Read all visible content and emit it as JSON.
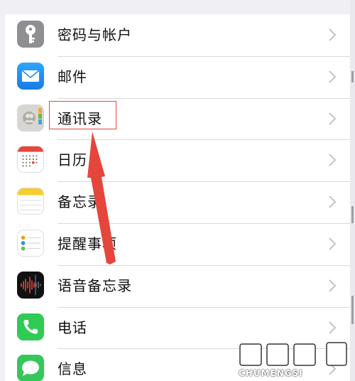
{
  "settings_list": {
    "items": [
      {
        "label": "密码与帐户",
        "icon": "key-icon"
      },
      {
        "label": "邮件",
        "icon": "mail-icon"
      },
      {
        "label": "通讯录",
        "icon": "contacts-icon"
      },
      {
        "label": "日历",
        "icon": "calendar-icon"
      },
      {
        "label": "备忘录",
        "icon": "notes-icon"
      },
      {
        "label": "提醒事项",
        "icon": "reminders-icon"
      },
      {
        "label": "语音备忘录",
        "icon": "voice-memos-icon"
      },
      {
        "label": "电话",
        "icon": "phone-icon"
      },
      {
        "label": "信息",
        "icon": "messages-icon"
      }
    ]
  },
  "annotation": {
    "highlighted_item": "通讯录",
    "color": "#e5463b"
  },
  "watermark": {
    "text": "CHUMENGSI"
  },
  "colors": {
    "mail": "#1a8cf2",
    "phone": "#2fcb54",
    "messages": "#36c75a",
    "voice_memos": "#111111",
    "key": "#8e8e93"
  }
}
